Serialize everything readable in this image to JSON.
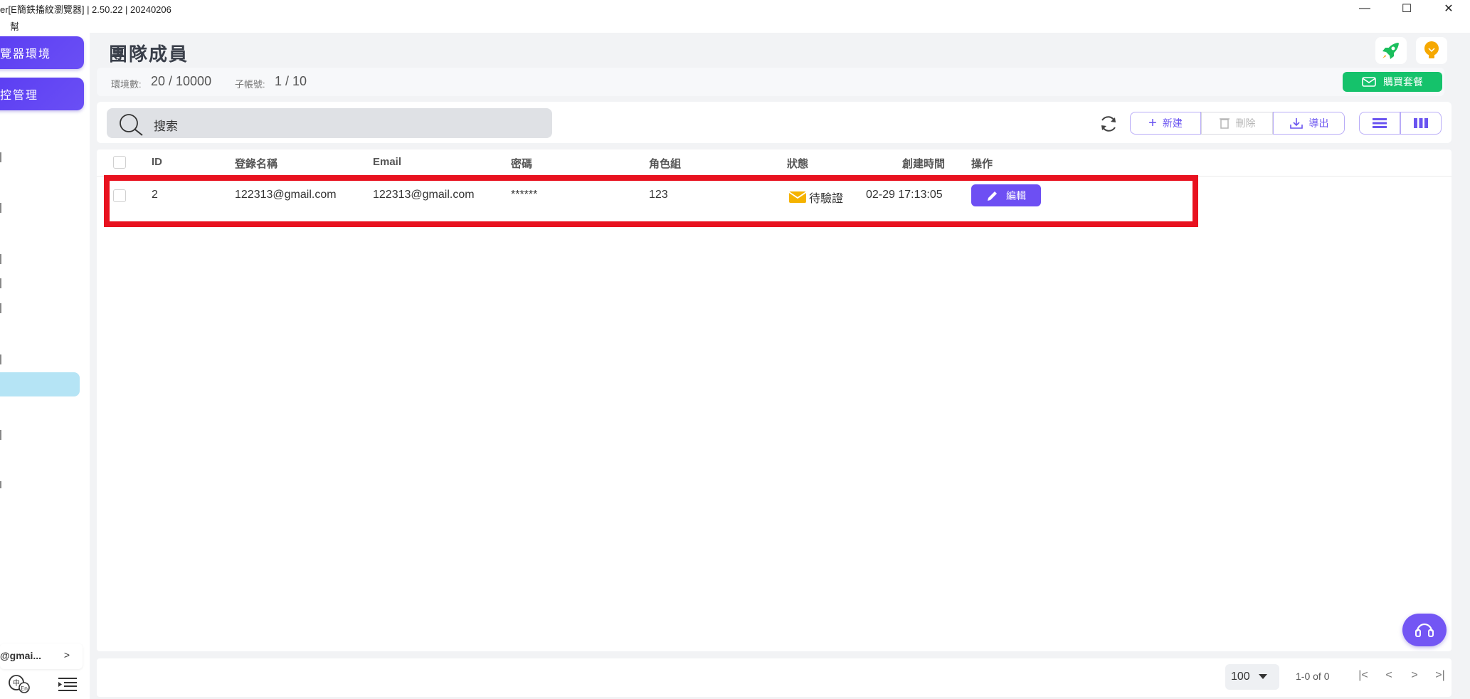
{
  "window": {
    "title": "er[E簡鉄搐紋瀏覽器] | 2.50.22 | 20240206",
    "menu_help": "幫助",
    "minimize": "—",
    "maximize": "☐",
    "close": "✕"
  },
  "sidebar": {
    "btn_browser_env": "覽器環境",
    "btn_control": "控管理",
    "marks": [
      "",
      "",
      "",
      "",
      "",
      "",
      "",
      ""
    ],
    "account_email": "@gmai...",
    "account_chevron": ">"
  },
  "header": {
    "title": "團隊成員"
  },
  "stats": {
    "env_label": "環境數:",
    "env_value": "20 / 10000",
    "sub_label": "子帳號:",
    "sub_value": "1 / 10",
    "buy_label": "購買套餐"
  },
  "toolbar": {
    "search_placeholder": "搜索",
    "new_label": "新建",
    "delete_label": "刪除",
    "export_label": "導出"
  },
  "table": {
    "columns": {
      "id": "ID",
      "login": "登錄名稱",
      "email": "Email",
      "password": "密碼",
      "role": "角色組",
      "status": "狀態",
      "created": "創建時間",
      "actions": "操作"
    },
    "rows": [
      {
        "id": "2",
        "login": "122313@gmail.com",
        "email": "122313@gmail.com",
        "password": "******",
        "role": "123",
        "status": "待驗證",
        "created": "02-29 17:13:05",
        "edit": "編輯"
      }
    ]
  },
  "pagination": {
    "page_size": "100",
    "range": "1-0 of 0",
    "first": "|<",
    "prev": "<",
    "next": ">",
    "last": ">|"
  },
  "colors": {
    "accent": "#6d4ff3",
    "buy_green": "#15c26b",
    "highlight_red": "#e8121f",
    "status_yellow": "#f5b300"
  }
}
